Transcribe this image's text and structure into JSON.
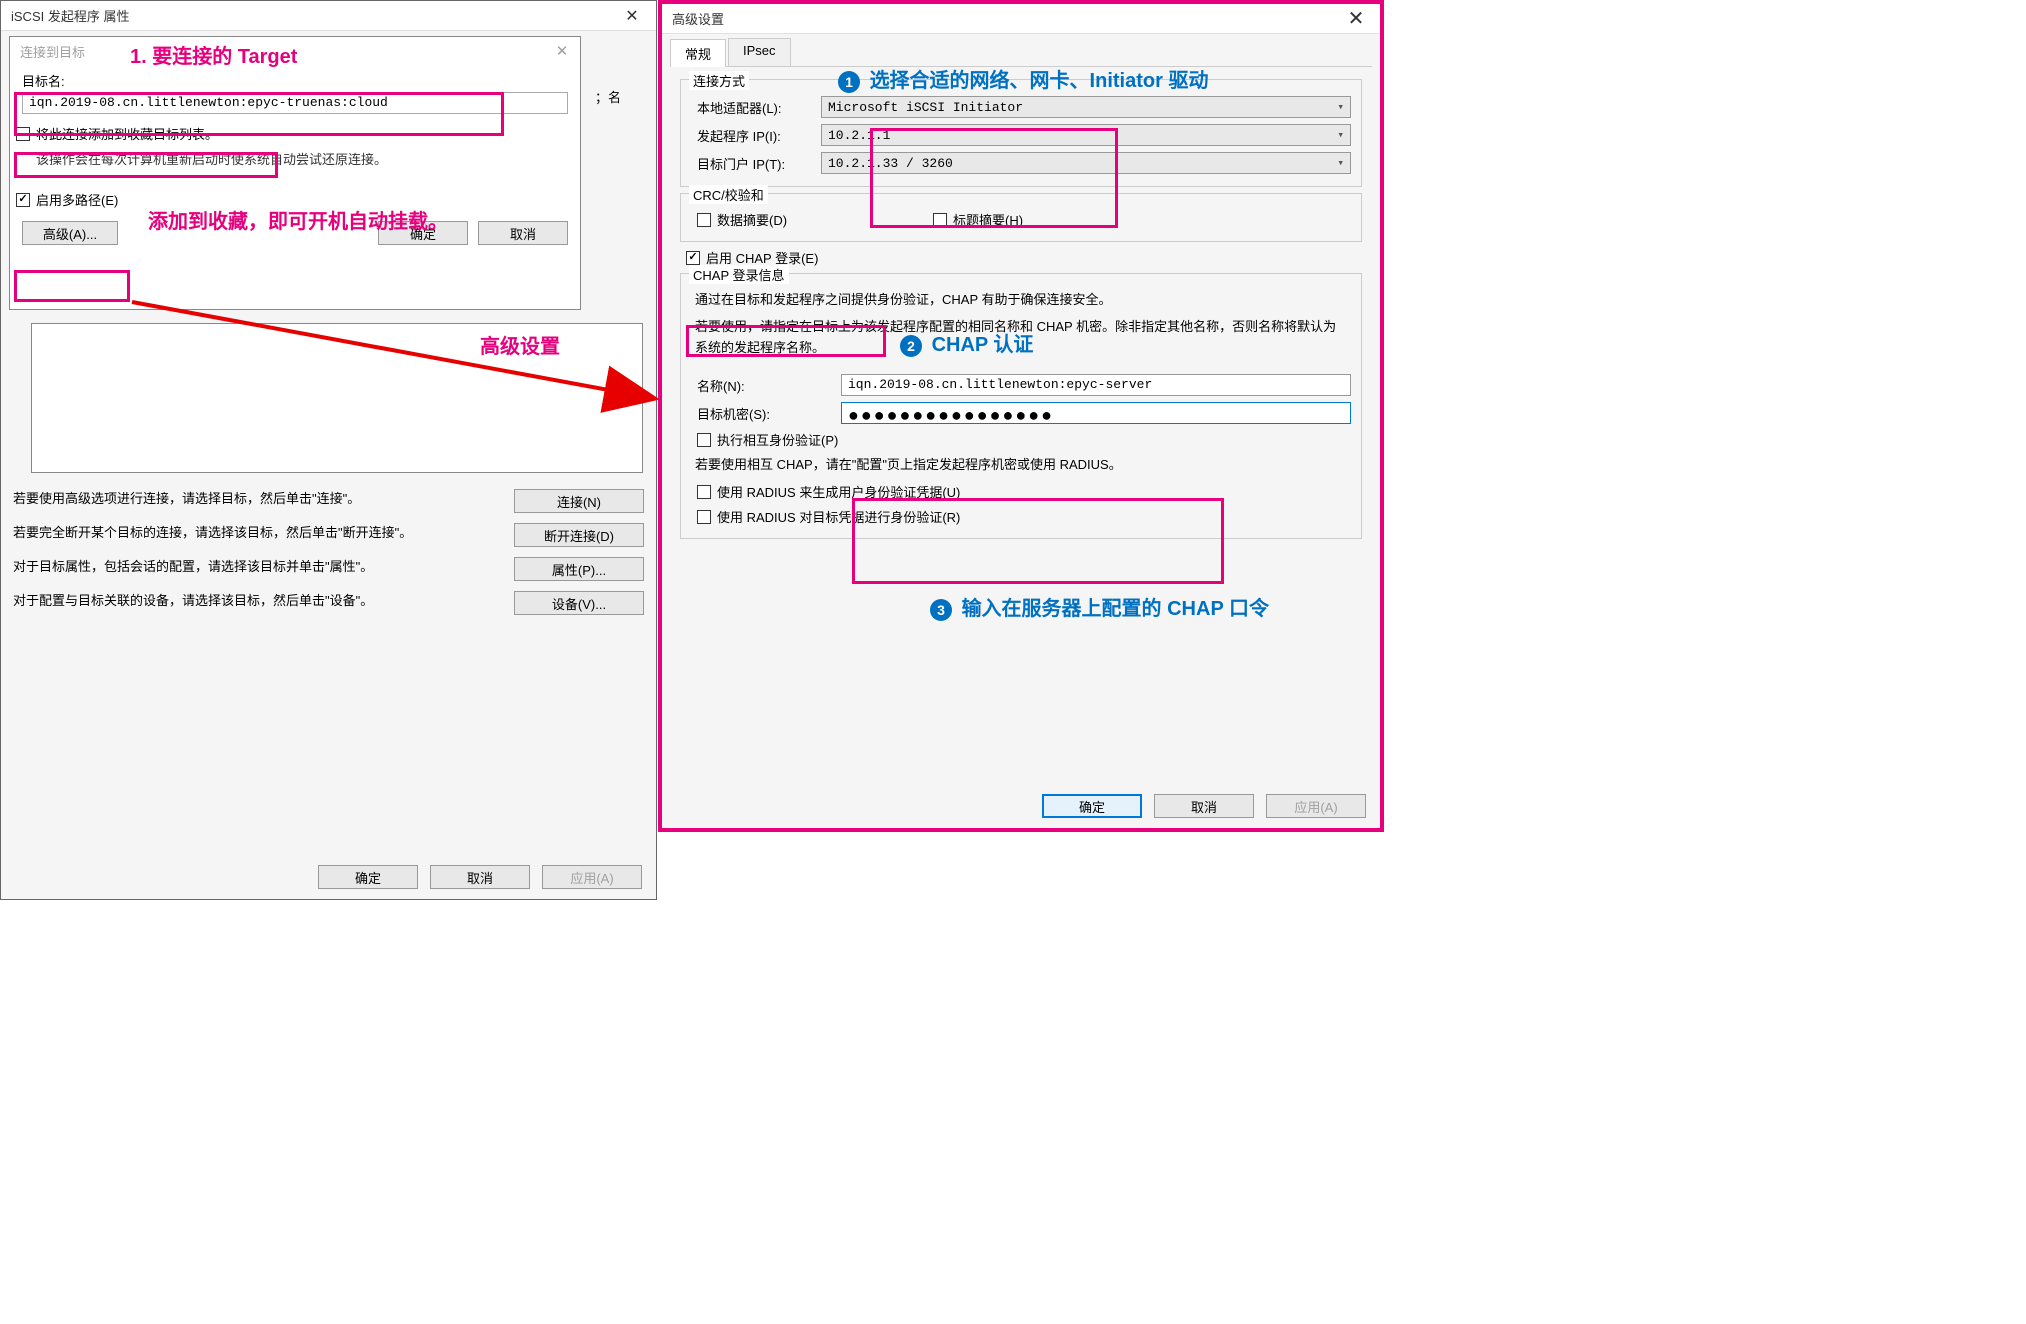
{
  "left": {
    "title": "iSCSI 发起程序 属性",
    "connect_dialog": {
      "title": "连接到目标",
      "target_label": "目标名:",
      "target_value": "iqn.2019-08.cn.littlenewton:epyc-truenas:cloud",
      "fav_checkbox": "将此连接添加到收藏目标列表。",
      "fav_help": "该操作会在每次计算机重新启动时使系统自动尝试还原连接。",
      "multipath": "启用多路径(E)",
      "advanced_btn": "高级(A)...",
      "ok": "确定",
      "cancel": "取消"
    },
    "peek_suffix": "；名",
    "help_connect": "若要使用高级选项进行连接，请选择目标，然后单击\"连接\"。",
    "btn_connect": "连接(N)",
    "help_disconnect": "若要完全断开某个目标的连接，请选择该目标，然后单击\"断开连接\"。",
    "btn_disconnect": "断开连接(D)",
    "help_props": "对于目标属性，包括会话的配置，请选择该目标并单击\"属性\"。",
    "btn_props": "属性(P)...",
    "help_devices": "对于配置与目标关联的设备，请选择该目标，然后单击\"设备\"。",
    "btn_devices": "设备(V)...",
    "ok": "确定",
    "cancel": "取消",
    "apply": "应用(A)"
  },
  "right": {
    "title": "高级设置",
    "tab_general": "常规",
    "tab_ipsec": "IPsec",
    "group_conn": "连接方式",
    "lbl_adapter": "本地适配器(L):",
    "val_adapter": "Microsoft iSCSI Initiator",
    "lbl_initiator_ip": "发起程序 IP(I):",
    "val_initiator_ip": "10.2.1.1",
    "lbl_target_portal": "目标门户 IP(T):",
    "val_target_portal": "10.2.1.33 / 3260",
    "group_crc": "CRC/校验和",
    "chk_data_digest": "数据摘要(D)",
    "chk_header_digest": "标题摘要(H)",
    "chk_chap": "启用 CHAP 登录(E)",
    "group_chap_info": "CHAP 登录信息",
    "chap_desc1": "通过在目标和发起程序之间提供身份验证，CHAP 有助于确保连接安全。",
    "chap_desc2": "若要使用，请指定在目标上为该发起程序配置的相同名称和 CHAP 机密。除非指定其他名称，否则名称将默认为系统的发起程序名称。",
    "lbl_name": "名称(N):",
    "val_name": "iqn.2019-08.cn.littlenewton:epyc-server",
    "lbl_secret": "目标机密(S):",
    "val_secret_masked": "●●●●●●●●●●●●●●●●",
    "chk_mutual": "执行相互身份验证(P)",
    "mutual_desc": "若要使用相互 CHAP，请在\"配置\"页上指定发起程序机密或使用 RADIUS。",
    "chk_radius_user": "使用 RADIUS 来生成用户身份验证凭据(U)",
    "chk_radius_target": "使用 RADIUS 对目标凭据进行身份验证(R)",
    "ok": "确定",
    "cancel": "取消",
    "apply": "应用(A)"
  },
  "annotations": {
    "a1": "1. 要连接的 Target",
    "a_fav": "添加到收藏，即可开机自动挂载。",
    "a_adv": "高级设置",
    "b1": "选择合适的网络、网卡、Initiator 驱动",
    "b2": "CHAP 认证",
    "b3": "输入在服务器上配置的 CHAP 口令"
  }
}
